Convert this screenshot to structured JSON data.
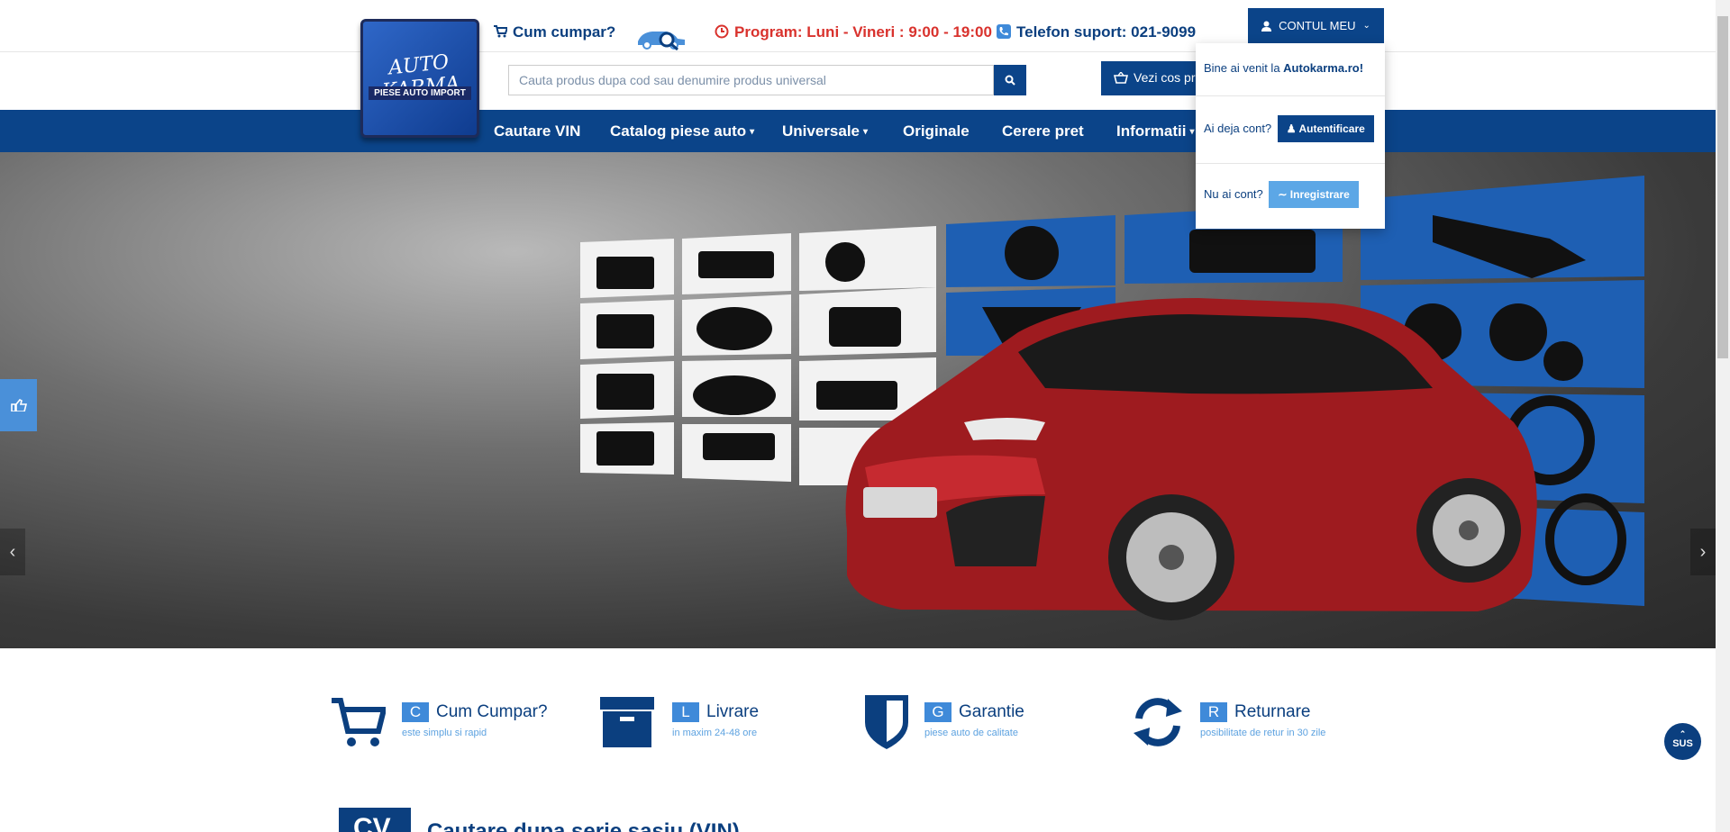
{
  "header": {
    "logo_line1": "AUTO KARMA",
    "logo_line2": "PIESE AUTO IMPORT",
    "cum_cumpar": "Cum cumpar?",
    "program": "Program: Luni - Vineri : 9:00 - 19:00",
    "telefon": "Telefon suport: 021-9099",
    "account_label": "CONTUL MEU"
  },
  "search": {
    "placeholder": "Cauta produs dupa cod sau denumire produs universal",
    "cart_label": "Vezi cos pr"
  },
  "nav": {
    "items": [
      {
        "label": "Cautare VIN"
      },
      {
        "label": "Catalog piese auto"
      },
      {
        "label": "Universale"
      },
      {
        "label": "Originale"
      },
      {
        "label": "Cerere pret"
      },
      {
        "label": "Informatii"
      }
    ]
  },
  "account_dropdown": {
    "welcome_prefix": "Bine ai venit la ",
    "welcome_brand": "Autokarma.ro!",
    "have_account": "Ai deja cont?",
    "login_label": "Autentificare",
    "no_account": "Nu ai cont?",
    "register_label": "Inregistrare"
  },
  "features": [
    {
      "letter": "C",
      "title": "Cum Cumpar?",
      "subtitle": "este simplu si rapid",
      "icon": "cart-icon"
    },
    {
      "letter": "L",
      "title": "Livrare",
      "subtitle": "in maxim 24-48 ore",
      "icon": "box-icon"
    },
    {
      "letter": "G",
      "title": "Garantie",
      "subtitle": "piese auto de calitate",
      "icon": "shield-icon"
    },
    {
      "letter": "R",
      "title": "Returnare",
      "subtitle": "posibilitate de retur in 30 zile",
      "icon": "refresh-icon"
    }
  ],
  "bottom": {
    "sv_code": "CV",
    "sv_title": "Cautare dupa serie sasiu (VIN)"
  },
  "sus_label": "SUS",
  "colors": {
    "primary": "#0b4489",
    "accent": "#3f8ad9",
    "red": "#d9322d"
  }
}
